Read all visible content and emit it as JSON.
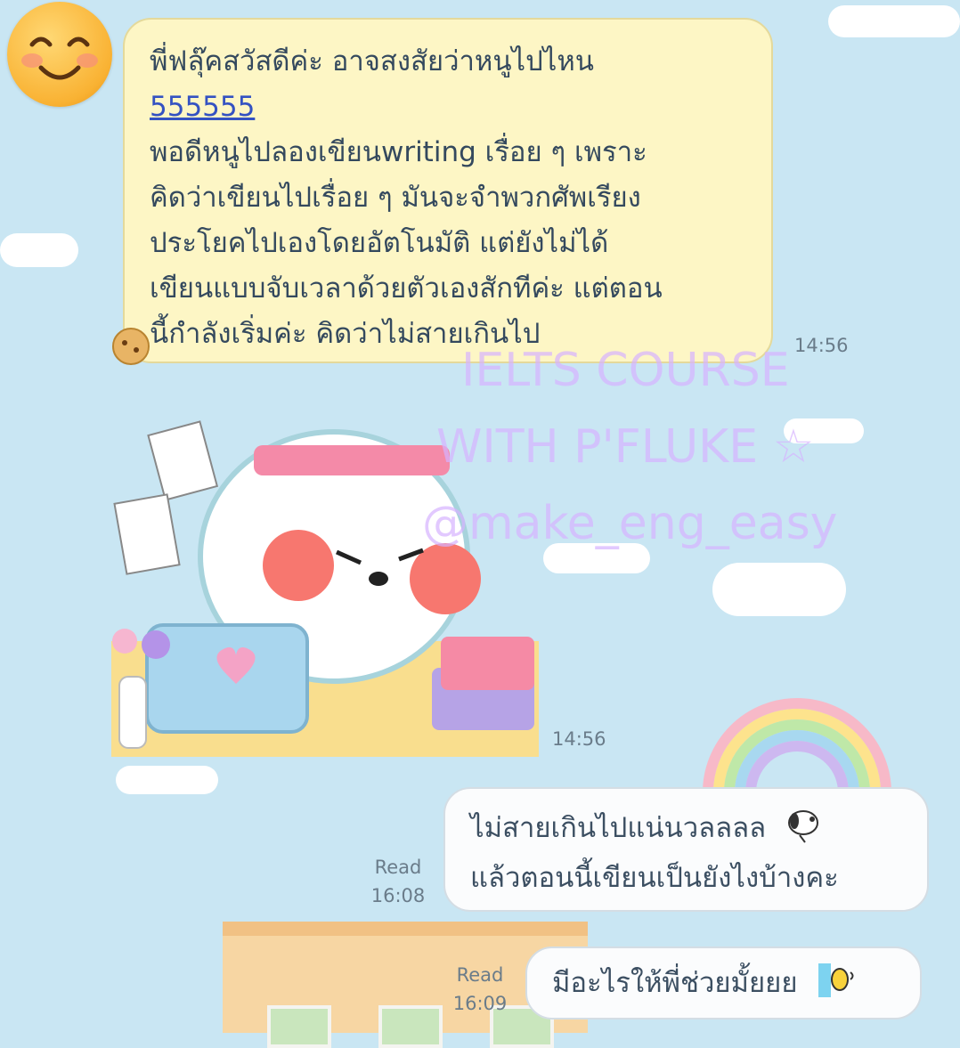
{
  "incoming_message": {
    "lines": [
      "พี่ฟลุ๊คสวัสดีค่ะ อาจสงสัยว่าหนูไปไหน",
      "555555",
      "พอดีหนูไปลองเขียนwriting เรื่อย ๆ เพราะ",
      "คิดว่าเขียนไปเรื่อย ๆ มันจะจำพวกศัพเรียง",
      "ประโยคไปเองโดยอัตโนมัติ แต่ยังไม่ได้",
      "เขียนแบบจับเวลาด้วยตัวเองสักทีค่ะ แต่ตอน",
      "นี้กำลังเริ่มค่ะ คิดว่าไม่สายเกินไป"
    ],
    "time": "14:56"
  },
  "sticker_message": {
    "time": "14:56"
  },
  "watermark": {
    "line1": "IELTS COURSE",
    "line2": "WITH P'FLUKE ☆",
    "line3": "@make_eng_easy"
  },
  "outgoing_messages": [
    {
      "lines": [
        "ไม่สายเกินไปแน่นวลลลล",
        "แล้วตอนนี้เขียนเป็นยังไงบ้างคะ"
      ],
      "read_label": "Read",
      "time": "16:08"
    },
    {
      "lines": [
        "มีอะไรให้พี่ช่วยมั้ยยย"
      ],
      "read_label": "Read",
      "time": "16:09"
    }
  ],
  "colors": {
    "background": "#c9e6f3",
    "incoming_bubble": "#fdf6c5",
    "outgoing_bubble": "#fbfcfd",
    "link": "#3452c2"
  },
  "icons": [
    "smiling-face-avatar-icon",
    "cookie-emoji-icon",
    "dog-sticker-icon",
    "snoopy-emoji-icon",
    "peeking-emoji-icon"
  ]
}
